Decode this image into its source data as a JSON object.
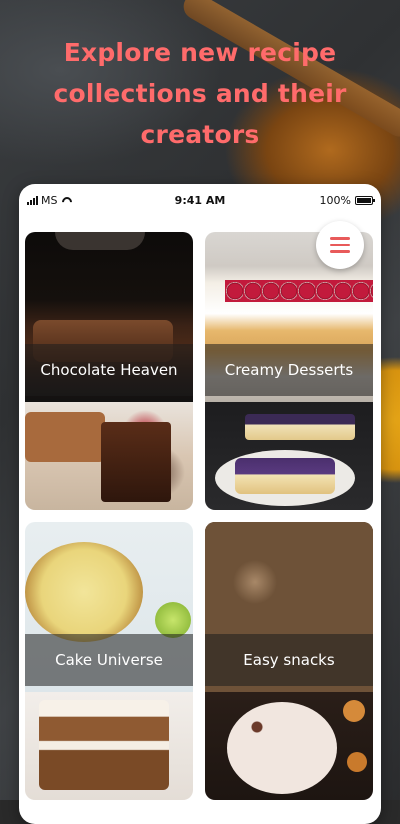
{
  "headline": [
    "Explore new recipe",
    "collections and their",
    "creators"
  ],
  "status": {
    "carrier": "MS",
    "time": "9:41 AM",
    "battery": "100%"
  },
  "collections": [
    {
      "label": "Chocolate Heaven"
    },
    {
      "label": "Creamy Desserts"
    },
    {
      "label": "Cake Universe"
    },
    {
      "label": "Easy snacks"
    }
  ],
  "colors": {
    "accent": "#ff6b6b",
    "menu_icon": "#e85a5a"
  },
  "icons": {
    "menu": "hamburger-menu-icon",
    "wifi": "wifi-icon",
    "signal": "signal-icon",
    "battery": "battery-icon"
  }
}
